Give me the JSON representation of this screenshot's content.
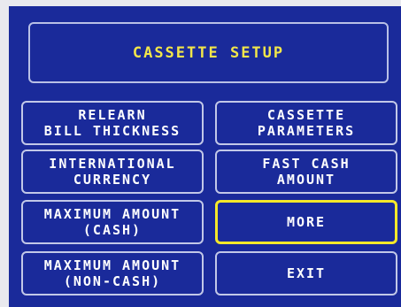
{
  "screen": {
    "title": "CASSETTE SETUP",
    "colors": {
      "background": "#1a2a9a",
      "title_text": "#f2e64a",
      "button_text": "#ffffff",
      "button_border": "#c2c8e8",
      "selected_border": "#f5e82a"
    }
  },
  "buttons": {
    "relearn_bill_thickness": {
      "line1": "RELEARN",
      "line2": "BILL THICKNESS"
    },
    "cassette_parameters": {
      "line1": "CASSETTE",
      "line2": "PARAMETERS"
    },
    "international_currency": {
      "line1": "INTERNATIONAL",
      "line2": "CURRENCY"
    },
    "fast_cash_amount": {
      "line1": "FAST CASH",
      "line2": "AMOUNT"
    },
    "maximum_amount_cash": {
      "line1": "MAXIMUM AMOUNT",
      "line2": "(CASH)"
    },
    "more": {
      "line1": "MORE"
    },
    "maximum_amount_non_cash": {
      "line1": "MAXIMUM AMOUNT",
      "line2": "(NON-CASH)"
    },
    "exit": {
      "line1": "EXIT"
    }
  }
}
